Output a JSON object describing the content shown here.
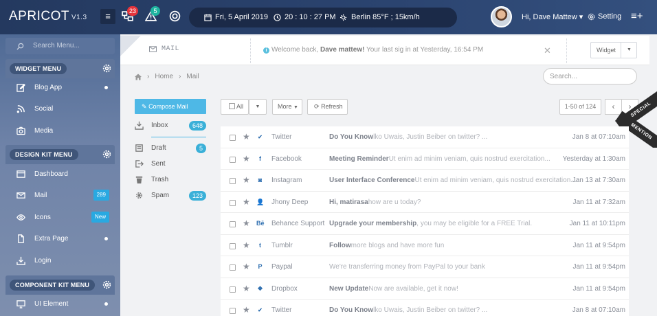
{
  "app": {
    "name": "APRICOT",
    "version": "V1.3"
  },
  "topbar": {
    "notifications": {
      "count": "23",
      "color": "#e5343b"
    },
    "alerts": {
      "count": "5",
      "color": "#1fb5a0"
    },
    "date": "Fri, 5 April 2019",
    "time": "20 : 10 : 27 PM",
    "weather": "Berlin  85°F ; 15km/h",
    "user": "Hi, Dave Mattew",
    "setting": "Setting"
  },
  "sidebar": {
    "search_placeholder": "Search Menu...",
    "sections": [
      {
        "title": "WIDGET MENU",
        "items": [
          {
            "label": "Blog App",
            "icon": "edit-icon",
            "dot": true
          },
          {
            "label": "Social",
            "icon": "rss-icon"
          },
          {
            "label": "Media",
            "icon": "camera-icon"
          }
        ]
      },
      {
        "title": "DESIGN KIT MENU",
        "items": [
          {
            "label": "Dashboard",
            "icon": "window-icon"
          },
          {
            "label": "Mail",
            "icon": "mail-icon",
            "badge": "289"
          },
          {
            "label": "Icons",
            "icon": "eye-icon",
            "badge": "New"
          },
          {
            "label": "Extra Page",
            "icon": "file-icon",
            "dot": true
          },
          {
            "label": "Login",
            "icon": "download-icon"
          }
        ]
      },
      {
        "title": "COMPONENT KIT MENU",
        "items": [
          {
            "label": "UI Element",
            "icon": "monitor-icon",
            "dot": true
          }
        ]
      }
    ]
  },
  "page": {
    "title": "MAIL",
    "welcome_prefix": "Welcome back,",
    "welcome_name": "Dave mattew!",
    "welcome_suffix": "Your last sig in at Yesterday, 16:54 PM",
    "widget_label": "Widget",
    "breadcrumb": [
      "Home",
      "Mail"
    ],
    "search_placeholder": "Search..."
  },
  "mail": {
    "compose_label": "Compose Mail",
    "folders": [
      {
        "label": "Inbox",
        "count": "648",
        "icon": "inbox-icon"
      },
      {
        "label": "Draft",
        "count": "5",
        "icon": "draft-icon"
      },
      {
        "label": "Sent",
        "icon": "sent-icon"
      },
      {
        "label": "Trash",
        "icon": "trash-icon"
      },
      {
        "label": "Spam",
        "count": "123",
        "icon": "spam-icon"
      }
    ],
    "toolbar": {
      "all_label": "All",
      "more_label": "More",
      "refresh_label": "Refresh",
      "pagination": "1-50 of 124"
    },
    "ribbon": [
      "SPECIAL",
      "MENTION"
    ],
    "messages": [
      {
        "source": "twitter-icon",
        "from": "Twitter",
        "subject": "Do You Know",
        "preview": "lko Uwais, Justin Beiber on twitter? ...",
        "date": "Jan 8 at 07:10am"
      },
      {
        "source": "facebook-icon",
        "from": "Facebook",
        "subject": "Meeting Reminder",
        "preview": "Ut enim ad minim veniam, quis nostrud exercitation...",
        "date": "Yesterday at 1:30am"
      },
      {
        "source": "instagram-icon",
        "from": "Instagram",
        "subject": "User Interface Conference",
        "preview": "Ut enim ad minim veniam, quis nostrud exercitation...",
        "date": "Jan 13 at 7:30am"
      },
      {
        "source": "user-icon",
        "from": "Jhony Deep",
        "subject": "Hi, matirasa",
        "preview": "how are u today?",
        "date": "Jan 11 at 7:32am"
      },
      {
        "source": "behance-icon",
        "from": "Behance Support",
        "subject": "Upgrade your membership",
        "preview": ", you may be eligible for a FREE Trial.",
        "date": "Jan 11 at 10:11pm"
      },
      {
        "source": "tumblr-icon",
        "from": "Tumblr",
        "subject": "Follow",
        "preview": "more blogs and have more fun",
        "date": "Jan 11 at 9:54pm"
      },
      {
        "source": "paypal-icon",
        "from": "Paypal",
        "subject": "",
        "preview": "We're transferring money from PayPal to your bank",
        "date": "Jan 11 at 9:54pm"
      },
      {
        "source": "dropbox-icon",
        "from": "Dropbox",
        "subject": "New Update",
        "preview": "Now are available, get it now!",
        "date": "Jan 11 at 9:54pm"
      },
      {
        "source": "twitter-icon",
        "from": "Twitter",
        "subject": "Do You Know",
        "preview": "lko Uwais, Justin Beiber on twitter? ...",
        "date": "Jan 8 at 07:10am"
      }
    ]
  }
}
